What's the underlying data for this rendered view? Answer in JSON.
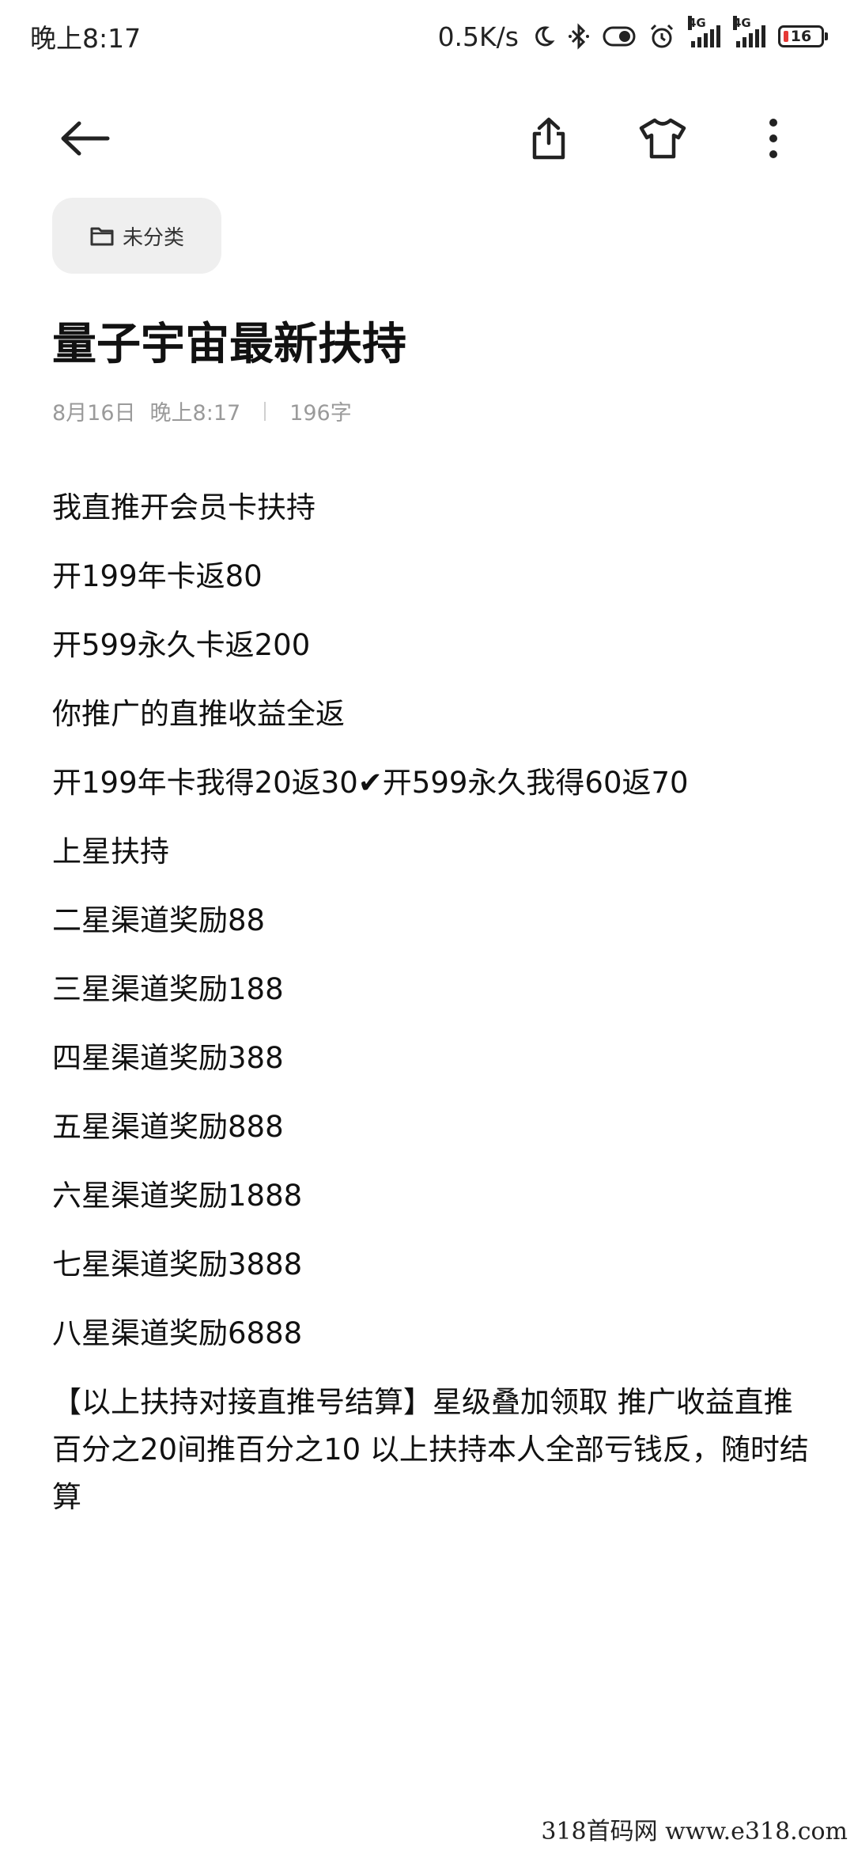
{
  "status_bar": {
    "time": "晚上8:17",
    "net_speed": "0.5K/s",
    "signal1_tag": "4G",
    "signal2_tag": "4G",
    "battery": "16",
    "icons": [
      "moon-icon",
      "bluetooth-icon",
      "toggle-icon",
      "alarm-icon",
      "signal-icon",
      "battery-icon"
    ]
  },
  "toolbar": {
    "icons": [
      "back-arrow-icon",
      "share-icon",
      "tshirt-theme-icon",
      "more-vertical-icon"
    ]
  },
  "note": {
    "category": "未分类",
    "category_icon": "folder-icon",
    "title": "量子宇宙最新扶持",
    "date": "8月16日",
    "time": "晚上8:17",
    "word_count": "196字",
    "lines": [
      "我直推开会员卡扶持",
      "开199年卡返80",
      "开599永久卡返200",
      "你推广的直推收益全返",
      "开199年卡我得20返30✔开599永久我得60返70",
      "上星扶持",
      "二星渠道奖励88",
      "三星渠道奖励188",
      "四星渠道奖励388",
      "五星渠道奖励888",
      "六星渠道奖励1888",
      "七星渠道奖励3888",
      "八星渠道奖励6888"
    ],
    "final_paragraph": [
      "【以上扶持对接直推号结算】星级叠加领取 推广收益直推",
      "百分之20间推百分之10 以上扶持本人全部亏钱反，随时结",
      "算"
    ]
  },
  "watermark": "318首码网  www.e318.com"
}
